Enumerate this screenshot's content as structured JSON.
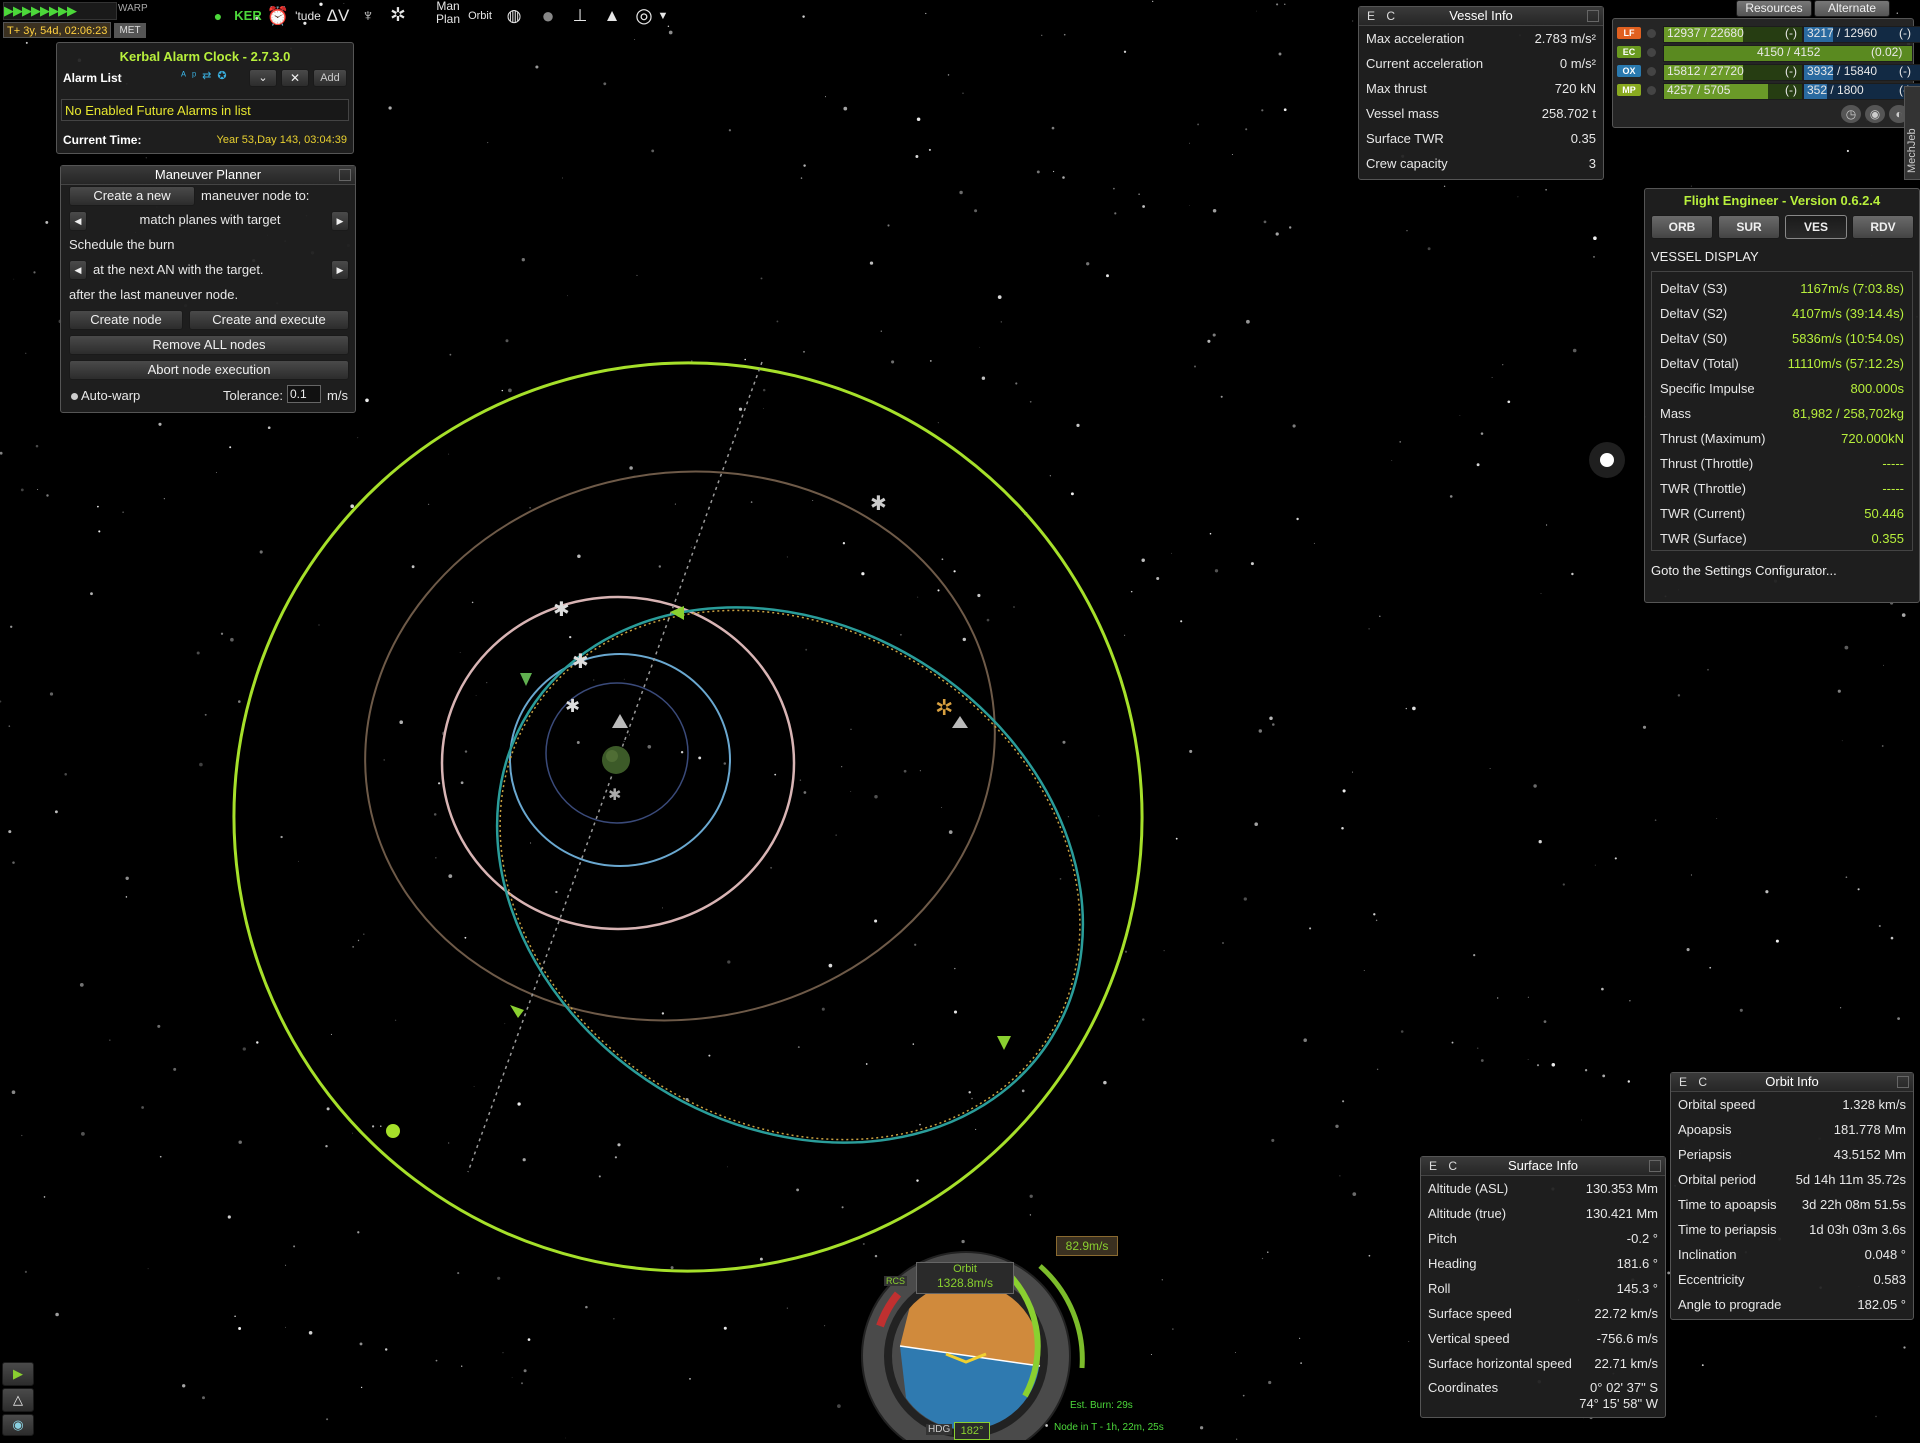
{
  "colors": {
    "accent": "#b8f03c",
    "orbit_target": "#a6e02a",
    "orbit_vessel": "#2a9d9a",
    "panel_bg": "#202020"
  },
  "top_left": {
    "met_time": "T+ 3y, 54d, 02:06:23",
    "warp_label": "WARP",
    "met_label": "MET"
  },
  "toolbar": {
    "icons": [
      "mic-icon",
      "ker-icon",
      "alarm-clock-icon",
      "attitude-icon",
      "delta-v-icon",
      "lander-icon",
      "settings-icon",
      "maneuver-plan-icon",
      "orbit-icon",
      "dock-icon",
      "planet-icon",
      "ascent-icon",
      "flask-icon",
      "target-icon",
      "dropdown-icon"
    ],
    "ker": "KER",
    "tude": "'tude",
    "dv": "ΔV",
    "man_plan_1": "Man",
    "man_plan_2": "Plan",
    "orbit": "Orbit"
  },
  "alarm_clock": {
    "title": "Kerbal Alarm Clock - 2.7.3.0",
    "list_label": "Alarm List",
    "add": "Add",
    "message": "No Enabled Future Alarms in list",
    "current_time_label": "Current Time:",
    "current_time": "Year 53,Day 143, 03:04:39"
  },
  "maneuver_planner": {
    "title": "Maneuver Planner",
    "create_new": "Create a new",
    "to_label": "maneuver node to:",
    "operation": "match planes with target",
    "schedule_label": "Schedule the burn",
    "timing": "at the next AN with the target.",
    "after_label": "after the last maneuver node.",
    "create_node": "Create node",
    "create_execute": "Create and execute",
    "remove_all": "Remove ALL nodes",
    "abort": "Abort node execution",
    "autowarp": "Auto-warp",
    "tolerance_label": "Tolerance:",
    "tolerance_value": "0.1",
    "tolerance_unit": "m/s"
  },
  "vessel_info": {
    "title": "Vessel Info",
    "ec": "E C",
    "rows": [
      {
        "label": "Max acceleration",
        "value": "2.783 m/s²"
      },
      {
        "label": "Current acceleration",
        "value": "0 m/s²"
      },
      {
        "label": "Max thrust",
        "value": "720 kN"
      },
      {
        "label": "Vessel mass",
        "value": "258.702 t"
      },
      {
        "label": "Surface TWR",
        "value": "0.35"
      },
      {
        "label": "Crew capacity",
        "value": "3"
      }
    ]
  },
  "resources": {
    "tab_resources": "Resources",
    "tab_alternate": "Alternate",
    "mechjeb_label": "MechJeb",
    "rows": [
      {
        "tag": "LF",
        "tag_color": "#e06020",
        "stage": "12937 / 22680",
        "stage_fill": 0.57,
        "stage_dash": "(-)",
        "total": "3217 / 12960",
        "total_fill": 0.25,
        "total_dash": "(-)"
      },
      {
        "tag": "EC",
        "tag_color": "#6a9a20",
        "stage": "",
        "stage_fill": 0,
        "stage_dash": "",
        "total": "4150 / 4152",
        "total_fill": 1.0,
        "total_dash": "(0.02)",
        "full": true
      },
      {
        "tag": "OX",
        "tag_color": "#2a7ab0",
        "stage": "15812 / 27720",
        "stage_fill": 0.57,
        "stage_dash": "(-)",
        "total": "3932 / 15840",
        "total_fill": 0.25,
        "total_dash": "(-)"
      },
      {
        "tag": "MP",
        "tag_color": "#8aaa20",
        "stage": "4257 / 5705",
        "stage_fill": 0.75,
        "stage_dash": "(-)",
        "total": "352 / 1800",
        "total_fill": 0.2,
        "total_dash": "(-)"
      }
    ]
  },
  "flight_engineer": {
    "title": "Flight Engineer  -  Version 0.6.2.4",
    "tabs": [
      "ORB",
      "SUR",
      "VES",
      "RDV"
    ],
    "active_tab": "VES",
    "section": "VESSEL DISPLAY",
    "rows": [
      {
        "label": "DeltaV (S3)",
        "value": "1167m/s (7:03.8s)"
      },
      {
        "label": "DeltaV (S2)",
        "value": "4107m/s (39:14.4s)"
      },
      {
        "label": "DeltaV (S0)",
        "value": "5836m/s (10:54.0s)"
      },
      {
        "label": "DeltaV (Total)",
        "value": "11110m/s (57:12.2s)"
      },
      {
        "label": "Specific Impulse",
        "value": "800.000s"
      },
      {
        "label": "Mass",
        "value": "81,982 / 258,702kg"
      },
      {
        "label": "Thrust (Maximum)",
        "value": "720.000kN"
      },
      {
        "label": "Thrust (Throttle)",
        "value": "-----"
      },
      {
        "label": "TWR (Throttle)",
        "value": "-----"
      },
      {
        "label": "TWR (Current)",
        "value": "50.446"
      },
      {
        "label": "TWR (Surface)",
        "value": "0.355"
      }
    ],
    "settings_link": "Goto the Settings Configurator..."
  },
  "orbit_info": {
    "title": "Orbit Info",
    "ec": "E C",
    "rows": [
      {
        "label": "Orbital speed",
        "value": "1.328 km/s"
      },
      {
        "label": "Apoapsis",
        "value": "181.778 Mm"
      },
      {
        "label": "Periapsis",
        "value": "43.5152 Mm"
      },
      {
        "label": "Orbital period",
        "value": "5d 14h 11m 35.72s"
      },
      {
        "label": "Time to apoapsis",
        "value": "3d 22h 08m 51.5s"
      },
      {
        "label": "Time to periapsis",
        "value": "1d 03h 03m 3.6s"
      },
      {
        "label": "Inclination",
        "value": "0.048 °"
      },
      {
        "label": "Eccentricity",
        "value": "0.583"
      },
      {
        "label": "Angle to prograde",
        "value": "182.05 °"
      }
    ]
  },
  "surface_info": {
    "title": "Surface Info",
    "ec": "E C",
    "rows": [
      {
        "label": "Altitude (ASL)",
        "value": "130.353 Mm"
      },
      {
        "label": "Altitude (true)",
        "value": "130.421 Mm"
      },
      {
        "label": "Pitch",
        "value": "-0.2 °"
      },
      {
        "label": "Heading",
        "value": "181.6 °"
      },
      {
        "label": "Roll",
        "value": "145.3 °"
      },
      {
        "label": "Surface speed",
        "value": "22.72 km/s"
      },
      {
        "label": "Vertical speed",
        "value": "-756.6 m/s"
      },
      {
        "label": "Surface horizontal speed",
        "value": "22.71 km/s"
      }
    ],
    "coord_label": "Coordinates",
    "coord_lat": "0° 02' 37\" S",
    "coord_lon": "74° 15' 58\" W"
  },
  "navball": {
    "mode": "Orbit",
    "speed": "1328.8m/s",
    "burn_dv": "82.9m/s",
    "heading": "182°",
    "hdg_label": "HDG",
    "rcs": "RCS",
    "est_burn": "Est. Burn: 29s",
    "node_time": "Node in T - 1h, 22m, 25s"
  }
}
